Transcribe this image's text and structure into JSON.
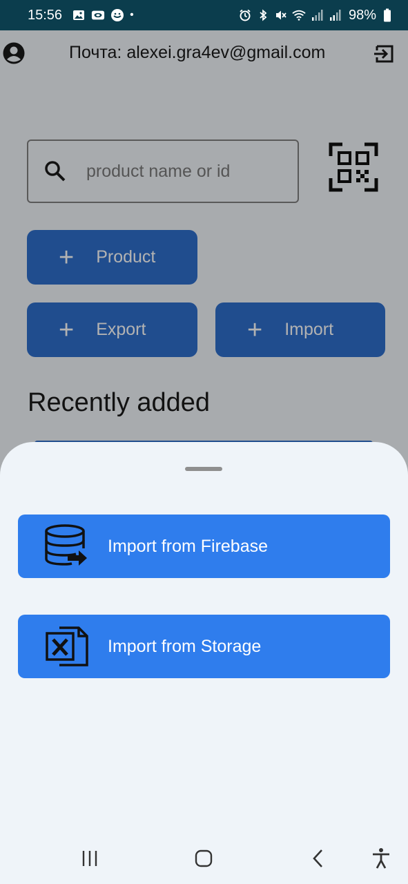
{
  "status_bar": {
    "time": "15:56",
    "battery": "98%",
    "dot": "•",
    "left_icons": [
      "gallery-icon",
      "camera-icon",
      "chat-icon"
    ],
    "right_icons": [
      "alarm-icon",
      "bluetooth-icon",
      "mute-icon",
      "wifi-icon",
      "signal-icon",
      "signal-icon",
      "battery-icon"
    ]
  },
  "topbar": {
    "email_label": "Почта: alexei.gra4ev@gmail.com"
  },
  "search": {
    "placeholder": "product name or id",
    "value": ""
  },
  "actions": {
    "plus": "+",
    "product_label": "Product",
    "export_label": "Export",
    "import_label": "Import"
  },
  "recent": {
    "title": "Recently added"
  },
  "sheet": {
    "firebase_label": "Import from Firebase",
    "storage_label": "Import from Storage"
  },
  "colors": {
    "status_bar": "#0b3d4d",
    "primary_button": "#2f6fcc",
    "sheet_button": "#2f7ded",
    "sheet_background": "#eff4f9"
  }
}
